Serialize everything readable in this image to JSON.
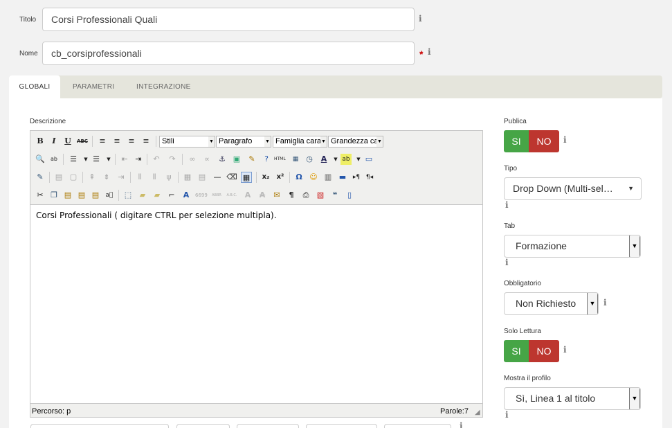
{
  "form": {
    "titolo_label": "Titolo",
    "titolo_value": "Corsi Professionali Quali",
    "nome_label": "Nome",
    "nome_value": "cb_corsiprofessionali",
    "required_mark": "*",
    "info_glyph": "i"
  },
  "tabs": [
    {
      "label": "GLOBALI",
      "active": true
    },
    {
      "label": "PARAMETRI",
      "active": false
    },
    {
      "label": "INTEGRAZIONE",
      "active": false
    }
  ],
  "editor": {
    "label": "Descrizione",
    "styles_select": "Stili",
    "format_select": "Paragrafo",
    "font_family_select": "Famiglia carat",
    "font_size_select": "Grandezza ca",
    "content_text": "Corsi Professionali ( digitare CTRL per selezione multipla).",
    "path_text": "Percorso: p",
    "word_count": "Parole:7"
  },
  "right": {
    "publica_label": "Publica",
    "publica_si": "SI",
    "publica_no": "NO",
    "tipo_label": "Tipo",
    "tipo_value": "Drop Down (Multi-sel…",
    "tab_label": "Tab",
    "tab_value": "Formazione",
    "obbligatorio_label": "Obbligatorio",
    "obbligatorio_value": "Non Richiesto",
    "sololettura_label": "Solo Lettura",
    "sololettura_si": "SI",
    "sololettura_no": "NO",
    "mostra_label": "Mostra il profilo",
    "mostra_value": "Sì, Linea 1 al titolo"
  },
  "colors": {
    "toggle_yes": "#46a546",
    "toggle_no": "#bd362f",
    "required": "#cc0000",
    "tabbar": "#e5e5dc"
  }
}
